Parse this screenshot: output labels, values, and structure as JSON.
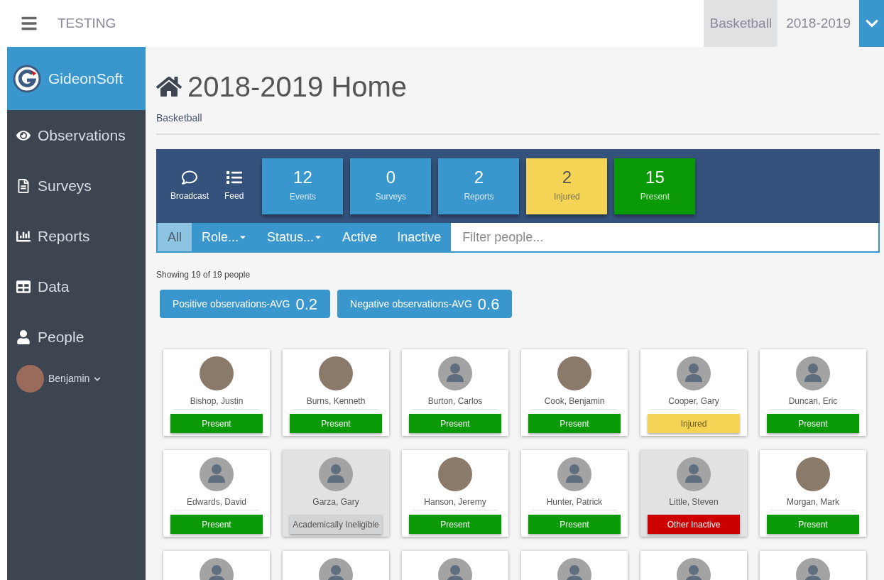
{
  "topbar": {
    "title": "TESTING",
    "sport": "Basketball",
    "season": "2018-2019"
  },
  "sidebar": {
    "brand": "GideonSoft",
    "items": [
      {
        "label": "Observations",
        "kind": "eye"
      },
      {
        "label": "Surveys",
        "kind": "file"
      },
      {
        "label": "Reports",
        "kind": "chart"
      },
      {
        "label": "Data",
        "kind": "table"
      },
      {
        "label": "People",
        "kind": "user"
      }
    ],
    "user": {
      "name": "Benjamin"
    }
  },
  "page": {
    "title": "2018-2019 Home",
    "subtitle": "Basketball"
  },
  "actions": [
    {
      "label": "Broadcast",
      "kind": "comment"
    },
    {
      "label": "Feed",
      "kind": "list"
    }
  ],
  "stats": [
    {
      "value": "12",
      "label": "Events",
      "color": "#3a97cd"
    },
    {
      "value": "0",
      "label": "Surveys",
      "color": "#3a97cd"
    },
    {
      "value": "2",
      "label": "Reports",
      "color": "#3a97cd"
    },
    {
      "value": "2",
      "label": "Injured",
      "color": "#f5d455"
    },
    {
      "value": "15",
      "label": "Present",
      "color": "#0a9a06"
    }
  ],
  "filters": [
    {
      "label": "All",
      "selected": true,
      "dropdown": false
    },
    {
      "label": "Role...",
      "selected": false,
      "dropdown": true
    },
    {
      "label": "Status...",
      "selected": false,
      "dropdown": true
    },
    {
      "label": "Active",
      "selected": false,
      "dropdown": false
    },
    {
      "label": "Inactive",
      "selected": false,
      "dropdown": false
    }
  ],
  "search": {
    "placeholder": "Filter people..."
  },
  "showing": "Showing 19 of 19 people",
  "averages": [
    {
      "label": "Positive observations-AVG",
      "value": "0.2"
    },
    {
      "label": "Negative observations-AVG",
      "value": "0.6"
    }
  ],
  "people": [
    {
      "name": "Bishop, Justin",
      "status": "Present",
      "kind": "present",
      "photo": true,
      "dimmed": false
    },
    {
      "name": "Burns, Kenneth",
      "status": "Present",
      "kind": "present",
      "photo": true,
      "dimmed": false
    },
    {
      "name": "Burton, Carlos",
      "status": "Present",
      "kind": "present",
      "photo": false,
      "dimmed": false
    },
    {
      "name": "Cook, Benjamin",
      "status": "Present",
      "kind": "present",
      "photo": true,
      "dimmed": false
    },
    {
      "name": "Cooper, Gary",
      "status": "Injured",
      "kind": "injured",
      "photo": false,
      "dimmed": false
    },
    {
      "name": "Duncan, Eric",
      "status": "Present",
      "kind": "present",
      "photo": false,
      "dimmed": false
    },
    {
      "name": "Edwards, David",
      "status": "Present",
      "kind": "present",
      "photo": false,
      "dimmed": false
    },
    {
      "name": "Garza, Gary",
      "status": "Academically Ineligible",
      "kind": "ineligible",
      "photo": false,
      "dimmed": true
    },
    {
      "name": "Hanson, Jeremy",
      "status": "Present",
      "kind": "present",
      "photo": true,
      "dimmed": false
    },
    {
      "name": "Hunter, Patrick",
      "status": "Present",
      "kind": "present",
      "photo": false,
      "dimmed": false
    },
    {
      "name": "Little, Steven",
      "status": "Other Inactive",
      "kind": "inactive",
      "photo": false,
      "dimmed": true
    },
    {
      "name": "Morgan, Mark",
      "status": "Present",
      "kind": "present",
      "photo": true,
      "dimmed": false
    },
    {
      "photo": false,
      "dimmed": false
    },
    {
      "photo": false,
      "dimmed": false
    },
    {
      "photo": false,
      "dimmed": false
    },
    {
      "photo": false,
      "dimmed": false
    },
    {
      "photo": false,
      "dimmed": false
    },
    {
      "photo": false,
      "dimmed": false
    }
  ]
}
